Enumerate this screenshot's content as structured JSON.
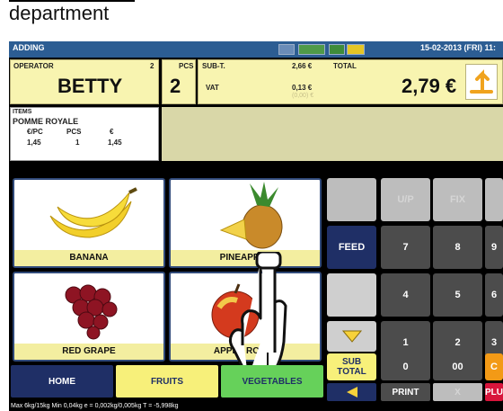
{
  "caption": "department",
  "titlebar": {
    "mode": "ADDING",
    "datetime": "15-02-2013 (FRI) 11:"
  },
  "header": {
    "operator_label": "OPERATOR",
    "operator_num": "2",
    "operator_name": "BETTY",
    "pcs_label": "PCS",
    "pcs_value": "2",
    "subt_label": "SUB-T.",
    "subt_value": "2,66 €",
    "vat_label": "VAT",
    "vat_value": "0,13 €",
    "vat_sub": "(0,00) €",
    "total_label": "TOTAL",
    "total_value": "2,79 €"
  },
  "items": {
    "label": "ITEMS",
    "name": "POMME ROYALE",
    "col1": "€/PC",
    "col2": "PCS",
    "col3": "€",
    "val1": "1,45",
    "val2": "1",
    "val3": "1,45"
  },
  "tiles": [
    "BANANA",
    "PINEAPPLE",
    "RED GRAPE",
    "APPLE ROYAL"
  ],
  "keys": {
    "up": "U/P",
    "fix": "FIX",
    "feed": "FEED",
    "k7": "7",
    "k8": "8",
    "k9": "9",
    "k4": "4",
    "k5": "5",
    "k6": "6",
    "k1": "1",
    "k2": "2",
    "k3": "3",
    "sub1": "SUB",
    "sub2": "TOTAL",
    "k0": "0",
    "k00": "00",
    "c": "C",
    "print": "PRINT",
    "x": "X",
    "plu": "PLU"
  },
  "bottom": {
    "home": "HOME",
    "fruits": "FRUITS",
    "vegetables": "VEGETABLES"
  },
  "status": "Max 6kg/15kg  Min 0,04kg  e = 0,002kg/0,005kg  T = -5,998kg",
  "colors": {
    "accent": "#2c5d93",
    "panel": "#f8f4b0",
    "navy": "#1f2f66",
    "green": "#66d15a",
    "orange": "#f39a16",
    "red": "#d8153b"
  }
}
